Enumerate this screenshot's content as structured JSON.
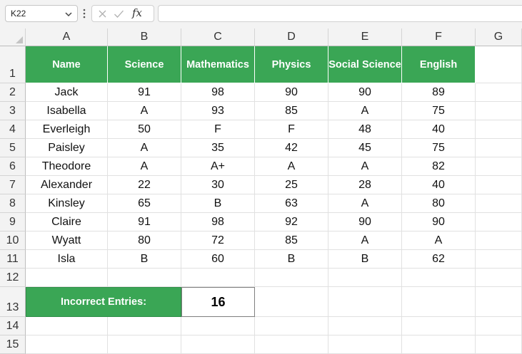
{
  "name_box": {
    "value": "K22"
  },
  "formula_bar": {
    "fx_label": "fx",
    "formula": ""
  },
  "columns": [
    "A",
    "B",
    "C",
    "D",
    "E",
    "F",
    "G"
  ],
  "rows": [
    "1",
    "2",
    "3",
    "4",
    "5",
    "6",
    "7",
    "8",
    "9",
    "10",
    "11",
    "12",
    "13",
    "14",
    "15"
  ],
  "table": {
    "headers": [
      "Name",
      "Science",
      "Mathematics",
      "Physics",
      "Social Science",
      "English"
    ],
    "data": [
      [
        "Jack",
        "91",
        "98",
        "90",
        "90",
        "89"
      ],
      [
        "Isabella",
        "A",
        "93",
        "85",
        "A",
        "75"
      ],
      [
        "Everleigh",
        "50",
        "F",
        "F",
        "48",
        "40"
      ],
      [
        "Paisley",
        "A",
        "35",
        "42",
        "45",
        "75"
      ],
      [
        "Theodore",
        "A",
        "A+",
        "A",
        "A",
        "82"
      ],
      [
        "Alexander",
        "22",
        "30",
        "25",
        "28",
        "40"
      ],
      [
        "Kinsley",
        "65",
        "B",
        "63",
        "A",
        "80"
      ],
      [
        "Claire",
        "91",
        "98",
        "92",
        "90",
        "90"
      ],
      [
        "Wyatt",
        "80",
        "72",
        "85",
        "A",
        "A"
      ],
      [
        "Isla",
        "B",
        "60",
        "B",
        "B",
        "62"
      ]
    ]
  },
  "summary": {
    "label": "Incorrect Entries:",
    "value": "16"
  },
  "colors": {
    "header_green": "#3aa655",
    "header_text": "#ffffff"
  }
}
